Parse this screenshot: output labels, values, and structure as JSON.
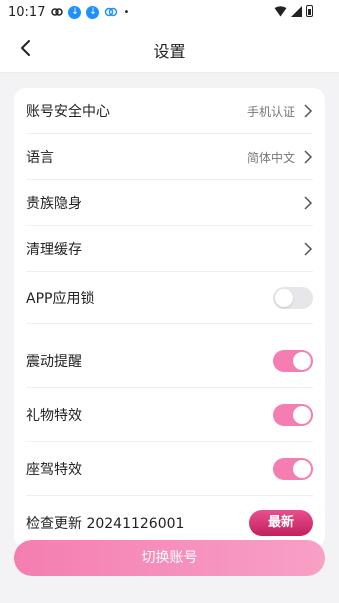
{
  "status_bar": {
    "time": "10:17"
  },
  "header": {
    "title": "设置"
  },
  "settings": {
    "account_security": {
      "label": "账号安全中心",
      "value": "手机认证"
    },
    "language": {
      "label": "语言",
      "value": "简体中文"
    },
    "noble_stealth": {
      "label": "贵族隐身"
    },
    "clear_cache": {
      "label": "清理缓存"
    },
    "app_lock": {
      "label": "APP应用锁",
      "enabled": false
    },
    "vibration": {
      "label": "震动提醒",
      "enabled": true
    },
    "gift_effects": {
      "label": "礼物特效",
      "enabled": true
    },
    "mount_effects": {
      "label": "座驾特效",
      "enabled": true
    },
    "check_update": {
      "label": "检查更新 20241126001",
      "badge": "最新"
    }
  },
  "switch_account": {
    "label": "切换账号"
  },
  "colors": {
    "accent": "#f57db1",
    "badge": "#d6336f"
  }
}
